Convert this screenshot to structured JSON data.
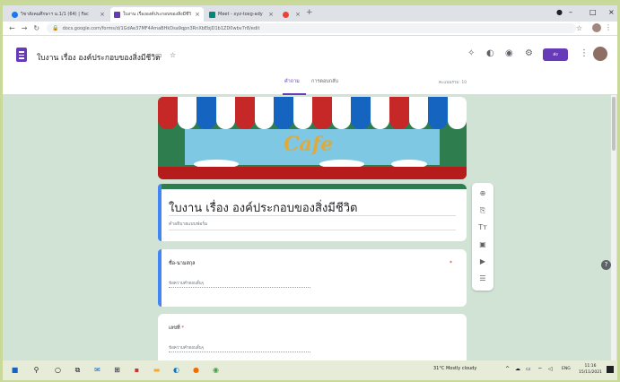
{
  "browser": {
    "tabs": [
      {
        "title": "วิชาสังคมศึกษาฯ ม.1/1 (64) | Fac",
        "favicon_color": "#1877f2"
      },
      {
        "title": "ใบงาน เรื่ององค์ประกอบของสิ่งมีชีวิต",
        "favicon_color": "#673ab7"
      },
      {
        "title": "Meet - xyz-toxg-ady",
        "favicon_color": "#00897b"
      },
      {
        "title": "",
        "favicon_color": "#ea4335"
      }
    ],
    "new_tab": "+",
    "url": "docs.google.com/forms/d/1GdAe37MF4AmaBHkDsa9qpn3RnXbEbjD1b1ZD0wbv7r8/edit",
    "min": "–",
    "max": "□",
    "close": "×"
  },
  "forms": {
    "doc_title": "ใบงาน เรื่อง องค์ประกอบของสิ่งมีชีวิต",
    "send_label": "ส่ง",
    "tab_questions": "คำถาม",
    "tab_responses": "การตอบกลับ",
    "saved_text": "คะแนนรวม: 10"
  },
  "banner": {
    "text": "Cafe"
  },
  "form_card": {
    "title": "ใบงาน เรื่อง องค์ประกอบของสิ่งมีชีวิต",
    "description": "คำอธิบายแบบฟอร์ม"
  },
  "questions": [
    {
      "label": "ชื่อ-นามสกุล",
      "required_mark": "*",
      "answer_placeholder": "ข้อความคำตอบสั้นๆ"
    },
    {
      "label": "เลขที่",
      "required_mark": "*",
      "answer_placeholder": "ข้อความคำตอบสั้นๆ"
    }
  ],
  "toolbar_icons": [
    "add-question-icon",
    "import-questions-icon",
    "add-title-icon",
    "add-image-icon",
    "add-video-icon",
    "add-section-icon"
  ],
  "taskbar": {
    "weather": "31°C  Mostly cloudy",
    "lang": "ENG",
    "time": "11:16",
    "date": "15/11/2021"
  }
}
